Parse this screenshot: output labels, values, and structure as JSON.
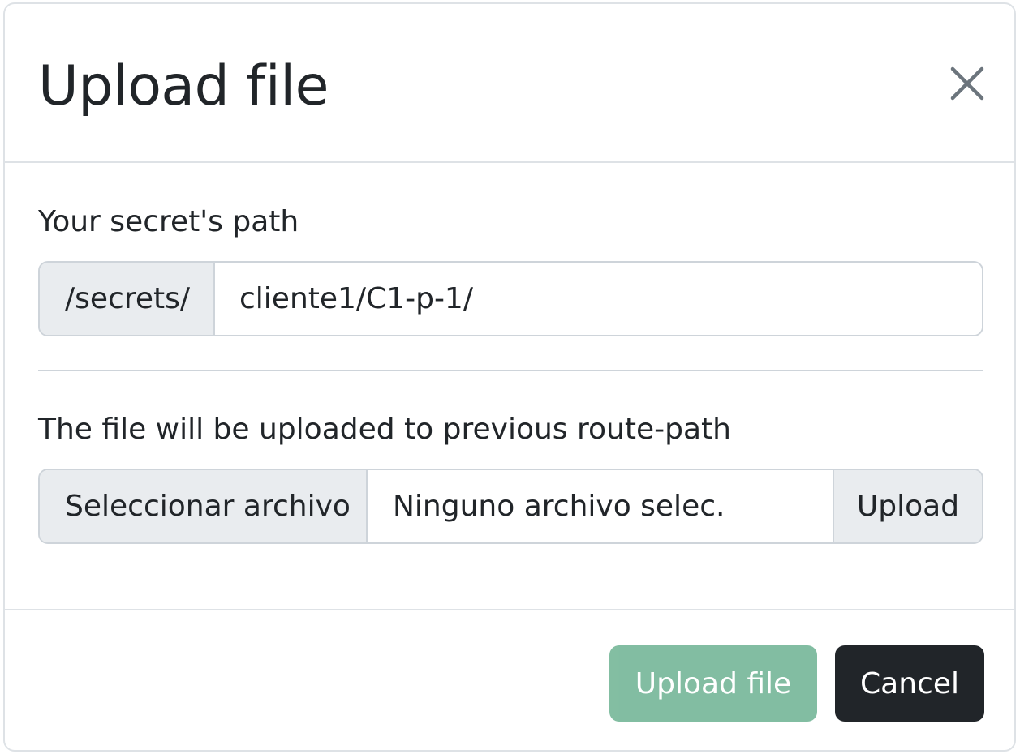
{
  "modal": {
    "title": "Upload file",
    "close_icon": "close-icon"
  },
  "path_section": {
    "label": "Your secret's path",
    "prefix": "/secrets/",
    "value": "cliente1/C1-p-1/"
  },
  "file_section": {
    "label": "The file will be uploaded to previous route-path",
    "choose_label": "Seleccionar archivo",
    "file_name": "Ninguno archivo selec.",
    "upload_label": "Upload"
  },
  "footer": {
    "submit_label": "Upload file",
    "cancel_label": "Cancel"
  },
  "colors": {
    "submit": "#198754",
    "cancel": "#212529",
    "addon_bg": "#e9ecef",
    "border": "#ced4da"
  }
}
